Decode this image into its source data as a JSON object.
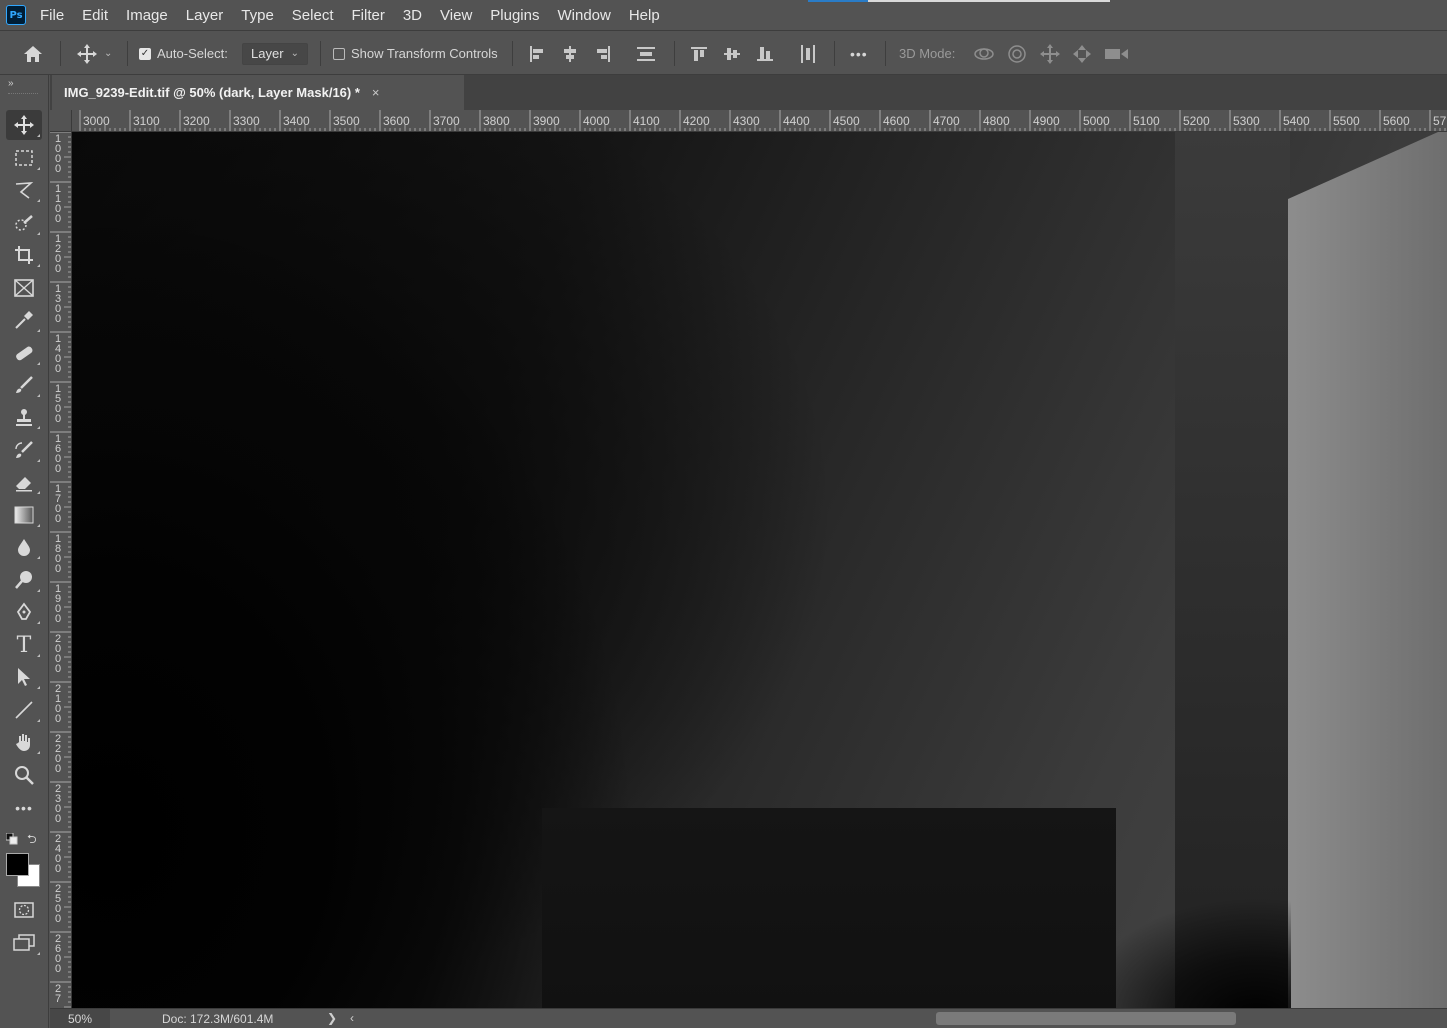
{
  "app": {
    "logo": "Ps",
    "accent_color": "#31a8ff"
  },
  "menu": [
    "File",
    "Edit",
    "Image",
    "Layer",
    "Type",
    "Select",
    "Filter",
    "3D",
    "View",
    "Plugins",
    "Window",
    "Help"
  ],
  "options": {
    "auto_select_label": "Auto-Select:",
    "auto_select_checked": true,
    "auto_select_target": "Layer",
    "show_transform_label": "Show Transform Controls",
    "show_transform_checked": false,
    "more_label": "•••",
    "mode_3d_label": "3D Mode:"
  },
  "document": {
    "tab_title": "IMG_9239-Edit.tif @ 50% (dark, Layer Mask/16) *",
    "close_glyph": "×"
  },
  "ruler": {
    "top_labels": [
      "3000",
      "3100",
      "3200",
      "3300",
      "3400",
      "3500",
      "3600",
      "3700",
      "3800",
      "3900",
      "4000",
      "4100",
      "4200",
      "4300",
      "4400",
      "4500",
      "4600",
      "4700",
      "4800",
      "4900",
      "5000",
      "5100",
      "5200",
      "5300",
      "5400",
      "5500",
      "5600",
      "57"
    ],
    "left_labels": [
      "1000",
      "1100",
      "1200",
      "1300",
      "1400",
      "1500",
      "1600",
      "1700",
      "1800",
      "1900",
      "2000",
      "2100",
      "2200",
      "2300",
      "2400",
      "2500",
      "2600",
      "27"
    ]
  },
  "status": {
    "zoom": "50%",
    "doc_info": "Doc: 172.3M/601.4M",
    "next_glyph": "❯",
    "prev_glyph": "‹"
  },
  "tools": [
    {
      "name": "move-tool",
      "glyph": "✥"
    },
    {
      "name": "rectangular-marquee-tool",
      "glyph": "⬚"
    },
    {
      "name": "lasso-tool",
      "glyph": "ᘏ"
    },
    {
      "name": "quick-selection-tool",
      "glyph": "✎"
    },
    {
      "name": "crop-tool",
      "glyph": "⌗"
    },
    {
      "name": "frame-tool",
      "glyph": "⊠"
    },
    {
      "name": "eyedropper-tool",
      "glyph": "✑"
    },
    {
      "name": "healing-brush-tool",
      "glyph": "✚"
    },
    {
      "name": "brush-tool",
      "glyph": "✏"
    },
    {
      "name": "clone-stamp-tool",
      "glyph": "⊥"
    },
    {
      "name": "history-brush-tool",
      "glyph": "✐"
    },
    {
      "name": "eraser-tool",
      "glyph": "⌫"
    },
    {
      "name": "gradient-tool",
      "glyph": "▧"
    },
    {
      "name": "blur-tool",
      "glyph": "💧"
    },
    {
      "name": "dodge-tool",
      "glyph": "⚲"
    },
    {
      "name": "pen-tool",
      "glyph": "✒"
    },
    {
      "name": "type-tool",
      "glyph": "T"
    },
    {
      "name": "path-selection-tool",
      "glyph": "➤"
    },
    {
      "name": "line-tool",
      "glyph": "╱"
    },
    {
      "name": "hand-tool",
      "glyph": "✋"
    },
    {
      "name": "zoom-tool",
      "glyph": "⚲"
    },
    {
      "name": "more-tools",
      "glyph": "•••"
    }
  ],
  "colors": {
    "foreground": "#000000",
    "background": "#ffffff"
  }
}
